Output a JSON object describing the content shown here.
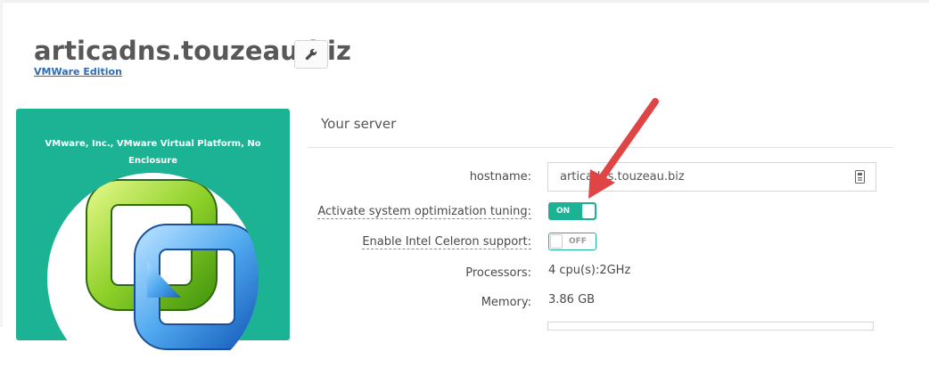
{
  "header": {
    "title": "articadns.touzeau.biz",
    "edition_link": "VMWare Edition",
    "settings_icon": "wrench-icon"
  },
  "card": {
    "hardware_text": "VMware, Inc., VMware Virtual Platform, No Enclosure",
    "logo_icon": "vmware-logo",
    "background_color": "#1cb394"
  },
  "server_panel": {
    "title": "Your server",
    "fields": {
      "hostname": {
        "label": "hostname:",
        "value": "articadns.touzeau.biz",
        "icon": "input-copy-icon"
      },
      "optimization": {
        "label": "Activate system optimization tuning:",
        "state_text": "ON",
        "state": true
      },
      "celeron": {
        "label": "Enable Intel Celeron support:",
        "state_text": "OFF",
        "state": false
      },
      "processors": {
        "label": "Processors:",
        "value": "4 cpu(s):2GHz"
      },
      "memory": {
        "label": "Memory:",
        "value": "3.86 GB"
      }
    }
  },
  "annotation": {
    "arrow_color": "#e04545"
  }
}
